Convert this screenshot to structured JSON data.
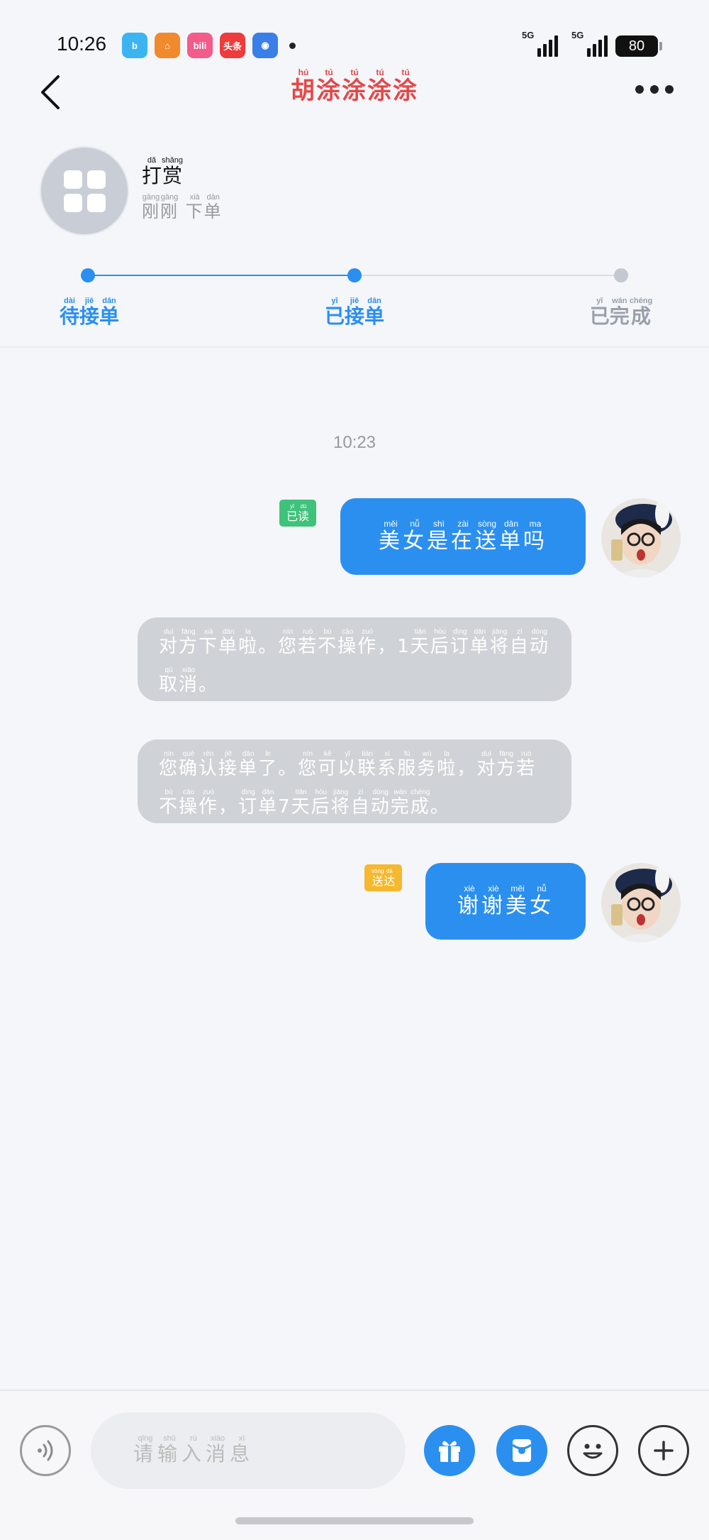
{
  "status_bar": {
    "time": "10:26",
    "apps": [
      {
        "name": "app-1",
        "color": "#3db4f2",
        "glyph": "b"
      },
      {
        "name": "app-2",
        "color": "#f08a2c",
        "glyph": "⌂"
      },
      {
        "name": "app-3",
        "color": "#f25b8a",
        "glyph": "bili"
      },
      {
        "name": "toutiao",
        "color": "#ee3b3b",
        "glyph": "头条"
      },
      {
        "name": "game",
        "color": "#3a7ee8",
        "glyph": "◉"
      }
    ],
    "signal_1_label": "5G",
    "signal_2_label": "5G",
    "battery": "80"
  },
  "header": {
    "title": [
      {
        "char": "胡",
        "py": "hú"
      },
      {
        "char": "涂",
        "py": "tú"
      },
      {
        "char": "涂",
        "py": "tú"
      },
      {
        "char": "涂",
        "py": "tú"
      },
      {
        "char": "涂",
        "py": "tú"
      }
    ]
  },
  "order": {
    "title": [
      {
        "char": "打",
        "py": "dǎ"
      },
      {
        "char": "赏",
        "py": "shǎng"
      }
    ],
    "subtitle": [
      {
        "char": "刚",
        "py": "gāng"
      },
      {
        "char": "刚",
        "py": "gāng"
      },
      {
        "char": " ",
        "py": ""
      },
      {
        "char": "下",
        "py": "xià"
      },
      {
        "char": "单",
        "py": "dān"
      }
    ]
  },
  "progress": {
    "steps": [
      {
        "chars": [
          {
            "char": "待",
            "py": "dài"
          },
          {
            "char": "接",
            "py": "jiē"
          },
          {
            "char": "单",
            "py": "dān"
          }
        ],
        "state": "done"
      },
      {
        "chars": [
          {
            "char": "已",
            "py": "yǐ"
          },
          {
            "char": "接",
            "py": "jiē"
          },
          {
            "char": "单",
            "py": "dān"
          }
        ],
        "state": "current"
      },
      {
        "chars": [
          {
            "char": "已",
            "py": "yǐ"
          },
          {
            "char": "完",
            "py": "wán"
          },
          {
            "char": "成",
            "py": "chéng"
          }
        ],
        "state": "pending"
      }
    ],
    "active_color": "#2b8ff0",
    "inactive_color": "#c4c8d2"
  },
  "chat": {
    "timestamp": "10:23",
    "messages": [
      {
        "type": "outgoing",
        "text": [
          {
            "char": "美",
            "py": "měi"
          },
          {
            "char": "女",
            "py": "nǚ"
          },
          {
            "char": "是",
            "py": "shì"
          },
          {
            "char": "在",
            "py": "zài"
          },
          {
            "char": "送",
            "py": "sòng"
          },
          {
            "char": "单",
            "py": "dān"
          },
          {
            "char": "吗",
            "py": "ma"
          }
        ],
        "tag": [
          {
            "char": "已",
            "py": "yǐ"
          },
          {
            "char": "读",
            "py": "dú"
          }
        ],
        "tag_color": "#3fc27a"
      },
      {
        "type": "system",
        "text": [
          {
            "char": "对",
            "py": "duì"
          },
          {
            "char": "方",
            "py": "fāng"
          },
          {
            "char": "下",
            "py": "xià"
          },
          {
            "char": "单",
            "py": "dān"
          },
          {
            "char": "啦",
            "py": "la"
          },
          {
            "char": "。",
            "py": ""
          },
          {
            "char": "您",
            "py": "nín"
          },
          {
            "char": "若",
            "py": "ruò"
          },
          {
            "char": "不",
            "py": "bù"
          },
          {
            "char": "操",
            "py": "cāo"
          },
          {
            "char": "作",
            "py": "zuò"
          },
          {
            "char": "，",
            "py": ""
          },
          {
            "char": "1",
            "py": ""
          },
          {
            "char": "天",
            "py": "tiān"
          },
          {
            "char": "后",
            "py": "hòu"
          },
          {
            "char": "订",
            "py": "dìng"
          },
          {
            "char": "单",
            "py": "dān"
          },
          {
            "char": "将",
            "py": "jiāng"
          },
          {
            "char": "自",
            "py": "zì"
          },
          {
            "char": "动",
            "py": "dòng"
          },
          {
            "char": "取",
            "py": "qǔ"
          },
          {
            "char": "消",
            "py": "xiāo"
          },
          {
            "char": "。",
            "py": ""
          }
        ]
      },
      {
        "type": "system",
        "text": [
          {
            "char": "您",
            "py": "nín"
          },
          {
            "char": "确",
            "py": "què"
          },
          {
            "char": "认",
            "py": "rèn"
          },
          {
            "char": "接",
            "py": "jiē"
          },
          {
            "char": "单",
            "py": "dān"
          },
          {
            "char": "了",
            "py": "le"
          },
          {
            "char": "。",
            "py": ""
          },
          {
            "char": "您",
            "py": "nín"
          },
          {
            "char": "可",
            "py": "kě"
          },
          {
            "char": "以",
            "py": "yǐ"
          },
          {
            "char": "联",
            "py": "lián"
          },
          {
            "char": "系",
            "py": "xì"
          },
          {
            "char": "服",
            "py": "fú"
          },
          {
            "char": "务",
            "py": "wù"
          },
          {
            "char": "啦",
            "py": "la"
          },
          {
            "char": "，",
            "py": ""
          },
          {
            "char": "对",
            "py": "duì"
          },
          {
            "char": "方",
            "py": "fāng"
          },
          {
            "char": "若",
            "py": "ruò"
          },
          {
            "char": "不",
            "py": "bù"
          },
          {
            "char": "操",
            "py": "cāo"
          },
          {
            "char": "作",
            "py": "zuò"
          },
          {
            "char": "，",
            "py": ""
          },
          {
            "char": "订",
            "py": "dìng"
          },
          {
            "char": "单",
            "py": "dān"
          },
          {
            "char": "7",
            "py": ""
          },
          {
            "char": "天",
            "py": "tiān"
          },
          {
            "char": "后",
            "py": "hòu"
          },
          {
            "char": "将",
            "py": "jiāng"
          },
          {
            "char": "自",
            "py": "zì"
          },
          {
            "char": "动",
            "py": "dòng"
          },
          {
            "char": "完",
            "py": "wán"
          },
          {
            "char": "成",
            "py": "chéng"
          },
          {
            "char": "。",
            "py": ""
          }
        ]
      },
      {
        "type": "outgoing",
        "text": [
          {
            "char": "谢",
            "py": "xiè"
          },
          {
            "char": "谢",
            "py": "xiè"
          },
          {
            "char": "美",
            "py": "měi"
          },
          {
            "char": "女",
            "py": "nǚ"
          }
        ],
        "tag": [
          {
            "char": "送",
            "py": "sòng"
          },
          {
            "char": "达",
            "py": "dá"
          }
        ],
        "tag_color": "#f5b82e"
      }
    ]
  },
  "input": {
    "placeholder": [
      {
        "char": "请",
        "py": "qǐng"
      },
      {
        "char": "输",
        "py": "shū"
      },
      {
        "char": "入",
        "py": "rù"
      },
      {
        "char": "消",
        "py": "xiāo"
      },
      {
        "char": "息",
        "py": "xī"
      }
    ]
  },
  "bottom_icons": [
    "voice-icon",
    "gift-icon",
    "red-packet-icon",
    "emoji-icon",
    "plus-icon"
  ],
  "colors": {
    "accent": "#2b8ff0",
    "title_red": "#e54848",
    "system_bubble": "#cfd2d6"
  }
}
